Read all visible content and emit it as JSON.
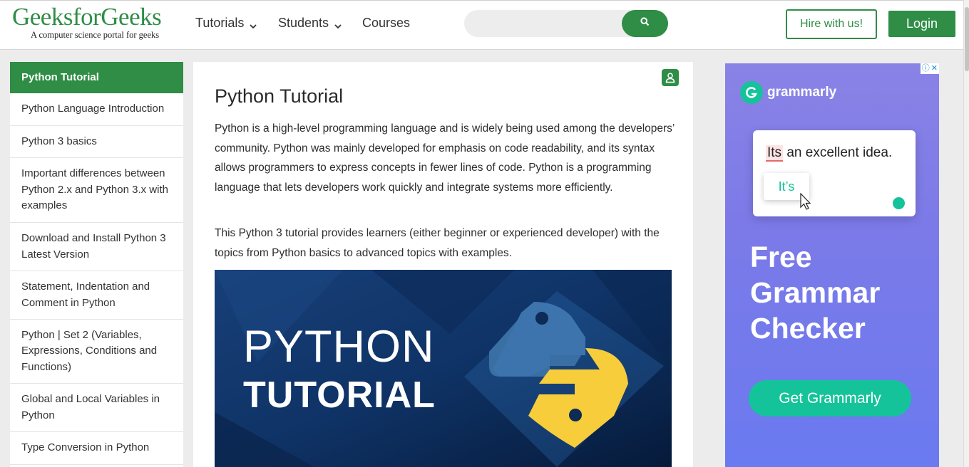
{
  "header": {
    "logo_main": "GeeksforGeeks",
    "logo_tagline": "A computer science portal for geeks",
    "nav": [
      {
        "label": "Tutorials",
        "has_dropdown": true
      },
      {
        "label": "Students",
        "has_dropdown": true
      },
      {
        "label": "Courses",
        "has_dropdown": false
      }
    ],
    "search": {
      "value": "",
      "placeholder": "",
      "icon": "search-icon"
    },
    "hire_label": "Hire with us!",
    "login_label": "Login"
  },
  "sidebar": {
    "heading": "Python Tutorial",
    "items": [
      {
        "label": "Python Language Introduction"
      },
      {
        "label": "Python 3 basics"
      },
      {
        "label": "Important differences between Python 2.x and Python 3.x with examples"
      },
      {
        "label": "Download and Install Python 3 Latest Version"
      },
      {
        "label": "Statement, Indentation and Comment in Python"
      },
      {
        "label": "Python | Set 2 (Variables, Expressions, Conditions and Functions)"
      },
      {
        "label": "Global and Local Variables in Python"
      },
      {
        "label": "Type Conversion in Python"
      }
    ]
  },
  "article": {
    "title": "Python Tutorial",
    "paragraphs": [
      "Python is a high-level programming language and is widely being used among the developers’ community. Python was mainly developed for emphasis on code readability, and its syntax allows programmers to express concepts in fewer lines of code. Python is a programming language that lets developers work quickly and integrate systems more efficiently.",
      "This Python 3 tutorial provides learners (either beginner or experienced developer) with the topics from Python basics to advanced topics with examples."
    ],
    "hero": {
      "line1": "PYTHON",
      "line2": "TUTORIAL"
    }
  },
  "ad": {
    "brand": "grammarly",
    "card_highlight": "Its",
    "card_rest": " an excellent idea.",
    "suggestion": "It’s",
    "headline": "Free Grammar Checker",
    "cta": "Get Grammarly",
    "info_glyph": "ⓘ",
    "close_glyph": "✕"
  },
  "colors": {
    "brand_green": "#2f8d46",
    "grammarly_green": "#15c39a",
    "ad_bg": "#7c7ae8"
  }
}
